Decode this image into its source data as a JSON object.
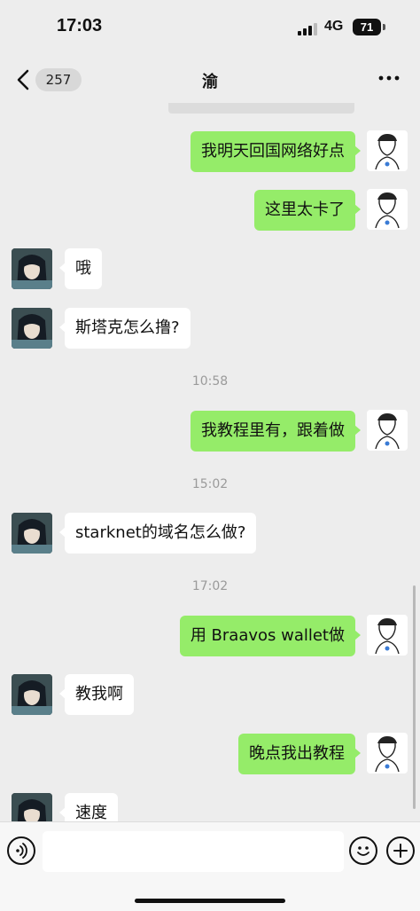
{
  "status_bar": {
    "time": "17:03",
    "network": "4G",
    "battery": "71"
  },
  "nav": {
    "unread_count": "257",
    "title": "渝"
  },
  "messages": [
    {
      "side": "out",
      "text": "我明天回国网络好点"
    },
    {
      "side": "out",
      "text": "这里太卡了"
    },
    {
      "side": "in",
      "text": "哦"
    },
    {
      "side": "in",
      "text": "斯塔克怎么撸?"
    },
    {
      "side": "out",
      "text": "我教程里有，跟着做"
    },
    {
      "side": "in",
      "text": "starknet的域名怎么做?"
    },
    {
      "side": "out",
      "text": "用 Braavos wallet做"
    },
    {
      "side": "in",
      "text": "教我啊"
    },
    {
      "side": "out",
      "text": "晚点我出教程"
    },
    {
      "side": "in",
      "text": "速度"
    }
  ],
  "timestamps": [
    "10:58",
    "15:02",
    "17:02"
  ],
  "input": {
    "placeholder": ""
  },
  "icons": {
    "back": "chevron-left-icon",
    "more": "ellipsis-icon",
    "voice": "voice-icon",
    "emoji": "emoji-icon",
    "plus": "plus-icon"
  },
  "colors": {
    "outgoing_bubble": "#95ec69",
    "incoming_bubble": "#ffffff",
    "background": "#ededed"
  }
}
